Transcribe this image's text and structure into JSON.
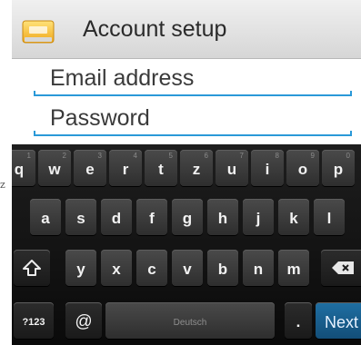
{
  "stray_char": "z",
  "header": {
    "title": "Account setup",
    "icon": "email-envelope-icon"
  },
  "form": {
    "email_placeholder": "Email address",
    "password_placeholder": "Password"
  },
  "keyboard": {
    "row1": [
      {
        "label": "q",
        "hint": "1"
      },
      {
        "label": "w",
        "hint": "2"
      },
      {
        "label": "e",
        "hint": "3"
      },
      {
        "label": "r",
        "hint": "4"
      },
      {
        "label": "t",
        "hint": "5"
      },
      {
        "label": "z",
        "hint": "6"
      },
      {
        "label": "u",
        "hint": "7"
      },
      {
        "label": "i",
        "hint": "8"
      },
      {
        "label": "o",
        "hint": "9"
      },
      {
        "label": "p",
        "hint": "0"
      }
    ],
    "row2": [
      "a",
      "s",
      "d",
      "f",
      "g",
      "h",
      "j",
      "k",
      "l"
    ],
    "row3": [
      "y",
      "x",
      "c",
      "v",
      "b",
      "n",
      "m"
    ],
    "shift_icon": "shift-arrow-icon",
    "backspace_icon": "backspace-icon",
    "symbols_label": "?123",
    "at_label": "@",
    "space_label": "Deutsch",
    "period_label": ".",
    "next_label": "Next",
    "accent_color": "#2a99d8",
    "next_color": "#1a5f8e"
  }
}
